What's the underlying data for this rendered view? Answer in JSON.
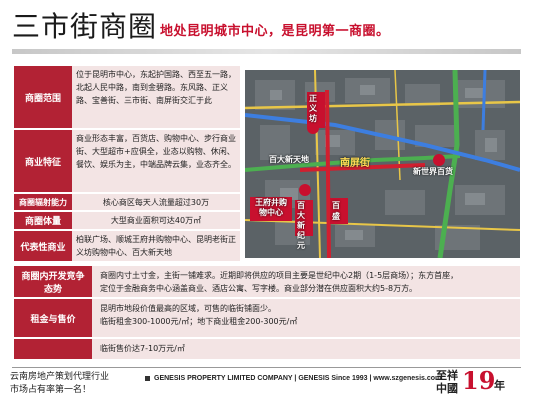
{
  "page": {
    "title": "三市街商圈",
    "subtitle": "地处昆明城市中心，是昆明第一商圈。"
  },
  "info_rows": [
    {
      "label": "商圈范围",
      "content": "位于昆明市中心，东起护国路、西至五一路，北起人民中路，南到金碧路。东风路、正义路、宝善街、三市街、南屏街交汇于此"
    },
    {
      "label": "商业特征",
      "content": "商业形态丰富，百货店、购物中心、步行商业街、大型超市+应俱全，业态以购物、休闲、餐饮、娱乐为主，中端品牌云集，业态齐全。"
    },
    {
      "label": "商圈辐射能力",
      "content": "核心商区每天人流量超过30万"
    },
    {
      "label": "商圈体量",
      "content": "大型商业面积可达40万㎡"
    },
    {
      "label": "代表性商业",
      "content": "柏联广场、顺城王府井购物中心、昆明老街正义坊购物中心、百大新天地"
    }
  ],
  "map": {
    "labels": {
      "zhengyifang": "正义坊",
      "baida_xintiandi": "百大新天地",
      "nanpingjie": "南屏街",
      "xinshijie": "新世界百货",
      "wangfujing": "王府井购物中心",
      "baida_xinjieshe": "百大新纪元",
      "baisheng": "百盛"
    }
  },
  "bottom_rows": [
    {
      "label": "商圈内开发竞争态势",
      "lines": [
        "商圈内寸土寸金，主街一铺难求。近期即将供应的项目主要是世纪中心2期（1-5层商场）；东方首座，",
        "定位于金融商务中心涵盖商业、酒店公寓、写字楼。商业部分潜在供应面积大约5-8万方。"
      ]
    },
    {
      "label": "租金与售价",
      "lines": [
        "昆明市地段价值最高的区域，可售的临街铺面少。",
        "临街租金300-1000元/㎡；地下商业租金200-300元/㎡"
      ]
    },
    {
      "label": "",
      "lines": [
        "临街售价达7-10万元/㎡"
      ]
    }
  ],
  "footer": {
    "left_line1": "云南房地产策划代理行业",
    "left_line2": "市场占有率第一名！",
    "company": "GENESIS PROPERTY LIMITED COMPANY | GENESIS Since 1993 | www.szgenesis.com",
    "logo_text_1": "至祥",
    "logo_text_2": "中國",
    "logo_number": "19",
    "logo_suffix": "年"
  }
}
